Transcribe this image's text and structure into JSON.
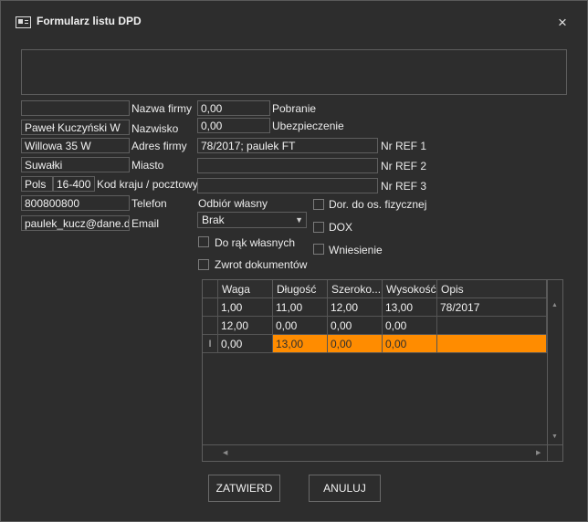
{
  "window": {
    "title": "Formularz listu DPD",
    "close_glyph": "×"
  },
  "notes_value": "",
  "left_fields": [
    {
      "value": "",
      "label": "Nazwa firmy"
    },
    {
      "value": "Paweł Kuczyński W",
      "label": "Nazwisko"
    },
    {
      "value": "Willowa 35 W",
      "label": "Adres firmy"
    },
    {
      "value": "Suwałki",
      "label": "Miasto"
    },
    {
      "value": "",
      "label": "Telefon"
    },
    {
      "value": "",
      "label": "Email"
    }
  ],
  "country_value": "Pols",
  "postal_value": "16-400",
  "postal_label": "Kod kraju / pocztowy",
  "phone_value": "800800800",
  "email_value": "paulek_kucz@dane.de",
  "pobranie": {
    "value": "0,00",
    "label": "Pobranie"
  },
  "ubezpieczenie": {
    "value": "0,00",
    "label": "Ubezpieczenie"
  },
  "refs": [
    {
      "value": "78/2017; paulek FT",
      "label": "Nr REF 1"
    },
    {
      "value": "",
      "label": "Nr REF 2"
    },
    {
      "value": "",
      "label": "Nr REF 3"
    }
  ],
  "odbior": {
    "label": "Odbiór własny",
    "value": "Brak",
    "arrow": "▼"
  },
  "checkboxes": {
    "do_rak": "Do rąk własnych",
    "zwrot": "Zwrot dokumentów",
    "dor_os": "Dor. do os. fizycznej",
    "dox": "DOX",
    "wniesienie": "Wniesienie"
  },
  "grid": {
    "columns": [
      "Waga",
      "Długość",
      "Szeroko...",
      "Wysokość",
      "Opis"
    ],
    "rows": [
      {
        "marker": "",
        "cells": [
          "1,00",
          "11,00",
          "12,00",
          "13,00",
          "78/2017"
        ]
      },
      {
        "marker": "",
        "cells": [
          "12,00",
          "0,00",
          "0,00",
          "0,00",
          ""
        ]
      },
      {
        "marker": "I",
        "cells": [
          "0,00",
          "13,00",
          "0,00",
          "0,00",
          ""
        ]
      }
    ],
    "selection_color": "#ff8c00"
  },
  "buttons": {
    "confirm": "ZATWIERD",
    "cancel": "ANULUJ"
  }
}
